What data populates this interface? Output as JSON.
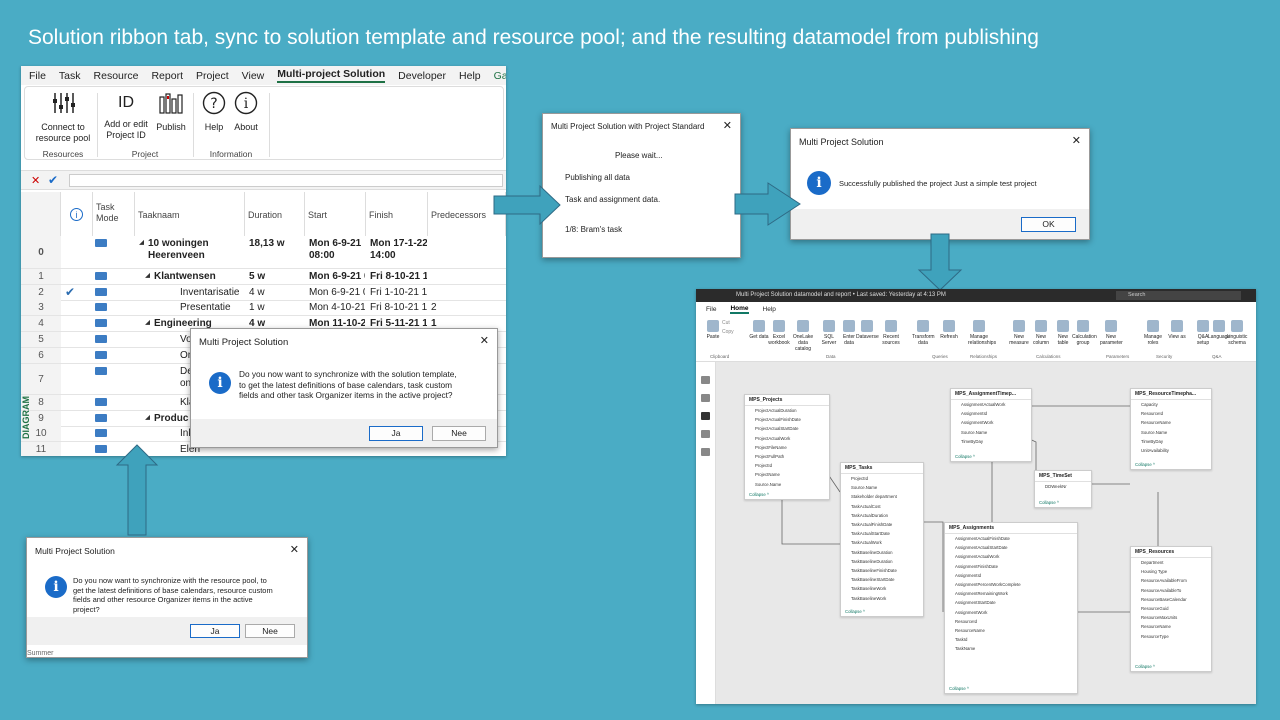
{
  "slide": {
    "title": "Solution ribbon tab, sync to solution template and resource pool; and the resulting datamodel from publishing"
  },
  "msp": {
    "menu": [
      "File",
      "Task",
      "Resource",
      "Report",
      "Project",
      "View",
      "Multi-project Solution",
      "Developer",
      "Help",
      "Ga"
    ],
    "ribbon": {
      "connect": "Connect to\nresource pool",
      "addedit": "Add or edit\nProject ID",
      "publish": "Publish",
      "help": "Help",
      "about": "About",
      "id_glyph": "ID",
      "g_resources": "Resources",
      "g_project": "Project",
      "g_information": "Information"
    },
    "headers": {
      "taskmode": "Task\nMode",
      "name": "Taaknaam",
      "duration": "Duration",
      "start": "Start",
      "finish": "Finish",
      "pred": "Predecessors"
    },
    "rows": [
      {
        "id": "0",
        "name": "10 woningen\nHeerenveen",
        "dur": "18,13 w",
        "start": "Mon 6-9-21\n08:00",
        "finish": "Mon 17-1-22\n14:00",
        "pred": "",
        "bold": true,
        "indent": 0,
        "check": false
      },
      {
        "id": "1",
        "name": "Klantwensen",
        "dur": "5 w",
        "start": "Mon 6-9-21 0",
        "finish": "Fri 8-10-21 1",
        "pred": "",
        "bold": true,
        "indent": 1,
        "check": false
      },
      {
        "id": "2",
        "name": "Inventarisatie",
        "dur": "4 w",
        "start": "Mon 6-9-21 0",
        "finish": "Fri 1-10-21 1",
        "pred": "",
        "bold": false,
        "indent": 2,
        "check": true
      },
      {
        "id": "3",
        "name": "Presentatie",
        "dur": "1 w",
        "start": "Mon 4-10-21",
        "finish": "Fri 8-10-21 1",
        "pred": "2",
        "bold": false,
        "indent": 2,
        "check": false
      },
      {
        "id": "4",
        "name": "Engineering",
        "dur": "4 w",
        "start": "Mon 11-10-2",
        "finish": "Fri 5-11-21 1",
        "pred": "1",
        "bold": true,
        "indent": 1,
        "check": false
      },
      {
        "id": "5",
        "name": "Voo",
        "dur": "",
        "start": "",
        "finish": "",
        "pred": "",
        "bold": false,
        "indent": 2,
        "check": false
      },
      {
        "id": "6",
        "name": "Ont",
        "dur": "",
        "start": "",
        "finish": "",
        "pred": "",
        "bold": false,
        "indent": 2,
        "check": false
      },
      {
        "id": "7",
        "name": "Defi\nontv",
        "dur": "",
        "start": "",
        "finish": "",
        "pred": "",
        "bold": false,
        "indent": 2,
        "check": false
      },
      {
        "id": "8",
        "name": "Klan",
        "dur": "",
        "start": "",
        "finish": "",
        "pred": "",
        "bold": false,
        "indent": 2,
        "check": false
      },
      {
        "id": "9",
        "name": "Produc",
        "dur": "",
        "start": "",
        "finish": "",
        "pred": "",
        "bold": true,
        "indent": 1,
        "check": false
      },
      {
        "id": "10",
        "name": "Inko",
        "dur": "",
        "start": "",
        "finish": "",
        "pred": "",
        "bold": false,
        "indent": 2,
        "check": false
      },
      {
        "id": "11",
        "name": "Elen",
        "dur": "",
        "start": "",
        "finish": "",
        "pred": "",
        "bold": false,
        "indent": 2,
        "check": false
      }
    ],
    "diagram": "DIAGRAM"
  },
  "dlg_template": {
    "title": "Multi Project Solution",
    "text": "Do you now want to synchronize with the solution template,\nto get the latest definitions of base calendars, task custom\nfields and other task Organizer items in the active project?",
    "yes": "Ja",
    "no": "Nee"
  },
  "dlg_pool": {
    "title": "Multi Project Solution",
    "text": "Do you now want to synchronize with the resource pool, to\nget the latest definitions of base calendars, resource custom\nfields and other resource Organizer items in the active\nproject?",
    "yes": "Ja",
    "no": "Nee",
    "below": "Summer"
  },
  "dlg_publishing": {
    "title": "Multi Project Solution with Project Standard",
    "wait": "Please wait...",
    "line1": "Publishing all data",
    "line2": "Task and assignment data.",
    "line3": "1/8: Bram's task"
  },
  "dlg_success": {
    "title": "Multi Project Solution",
    "text": "Successfully published the project Just a simple test project",
    "ok": "OK"
  },
  "pbi": {
    "titlebar": "Multi Project Solution datamodel and report • Last saved: Yesterday at 4:13 PM",
    "search": "Search",
    "menu": [
      "File",
      "Home",
      "Help"
    ],
    "ribbon": [
      {
        "label": "Paste",
        "sub": ""
      },
      {
        "label": "Get data",
        "sub": ""
      },
      {
        "label": "Excel workbook",
        "sub": ""
      },
      {
        "label": "OneLake data catalog",
        "sub": ""
      },
      {
        "label": "SQL Server",
        "sub": ""
      },
      {
        "label": "Enter data",
        "sub": ""
      },
      {
        "label": "Dataverse",
        "sub": ""
      },
      {
        "label": "Recent sources",
        "sub": ""
      },
      {
        "label": "Transform data",
        "sub": ""
      },
      {
        "label": "Refresh",
        "sub": ""
      },
      {
        "label": "Manage relationships",
        "sub": ""
      },
      {
        "label": "New measure",
        "sub": ""
      },
      {
        "label": "New column",
        "sub": ""
      },
      {
        "label": "New table",
        "sub": ""
      },
      {
        "label": "Calculation group",
        "sub": ""
      },
      {
        "label": "New parameter",
        "sub": ""
      },
      {
        "label": "Manage roles",
        "sub": ""
      },
      {
        "label": "View as",
        "sub": ""
      },
      {
        "label": "Q&A setup",
        "sub": ""
      },
      {
        "label": "Language",
        "sub": ""
      },
      {
        "label": "Linguistic schema",
        "sub": ""
      }
    ],
    "clip": [
      "Cut",
      "Copy"
    ],
    "groups": [
      "Clipboard",
      "Data",
      "Queries",
      "Relationships",
      "Calculations",
      "Parameters",
      "Security",
      "Q&A"
    ],
    "tables": [
      {
        "name": "MPS_Projects",
        "fields": [
          "ProjectActualDuration",
          "ProjectActualFinishDate",
          "ProjectActualStartDate",
          "ProjectActualWork",
          "ProjectFileName",
          "ProjectFullPath",
          "ProjectId",
          "ProjectName",
          "Source.Name"
        ]
      },
      {
        "name": "MPS_AssignmentTimep...",
        "fields": [
          "AssignmentActualWork",
          "AssignmentId",
          "AssignmentWork",
          "Source.Name",
          "TimeByDay"
        ]
      },
      {
        "name": "MPS_ResourceTimepha...",
        "fields": [
          "Capacity",
          "ResourceId",
          "ResourceName",
          "Source.Name",
          "TimeByDay",
          "UnitAvailability"
        ]
      },
      {
        "name": "MPS_Tasks",
        "fields": [
          "ProjectId",
          "Source.Name",
          "Stakeholder department",
          "TaskActualCost",
          "TaskActualDuration",
          "TaskActualFinishDate",
          "TaskActualStartDate",
          "TaskActualWork",
          "TaskBaselineDuration",
          "TaskBaselineDuration",
          "TaskBaselineFinishDate",
          "TaskBaselineStartDate",
          "TaskBaselineWork",
          "TaskBaselineWork"
        ]
      },
      {
        "name": "MPS_TimeSet",
        "fields": [
          "DDWeekNr"
        ]
      },
      {
        "name": "MPS_Assignments",
        "fields": [
          "AssignmentActualFinishDate",
          "AssignmentActualStartDate",
          "AssignmentActualWork",
          "AssignmentFinishDate",
          "AssignmentId",
          "AssignmentPercentWorkComplete",
          "AssignmentRemainingWork",
          "AssignmentStartDate",
          "AssignmentWork",
          "ResourceId",
          "ResourceName",
          "TaskId",
          "TaskName"
        ]
      },
      {
        "name": "MPS_Resources",
        "fields": [
          "Department",
          "Housing Type",
          "ResourceAvailableFrom",
          "ResourceAvailableTo",
          "ResourceBaseCalendar",
          "ResourceGuid",
          "ResourceMaxUnits",
          "ResourceName",
          "ResourceType"
        ]
      }
    ],
    "collapse": "Collapse ^"
  }
}
